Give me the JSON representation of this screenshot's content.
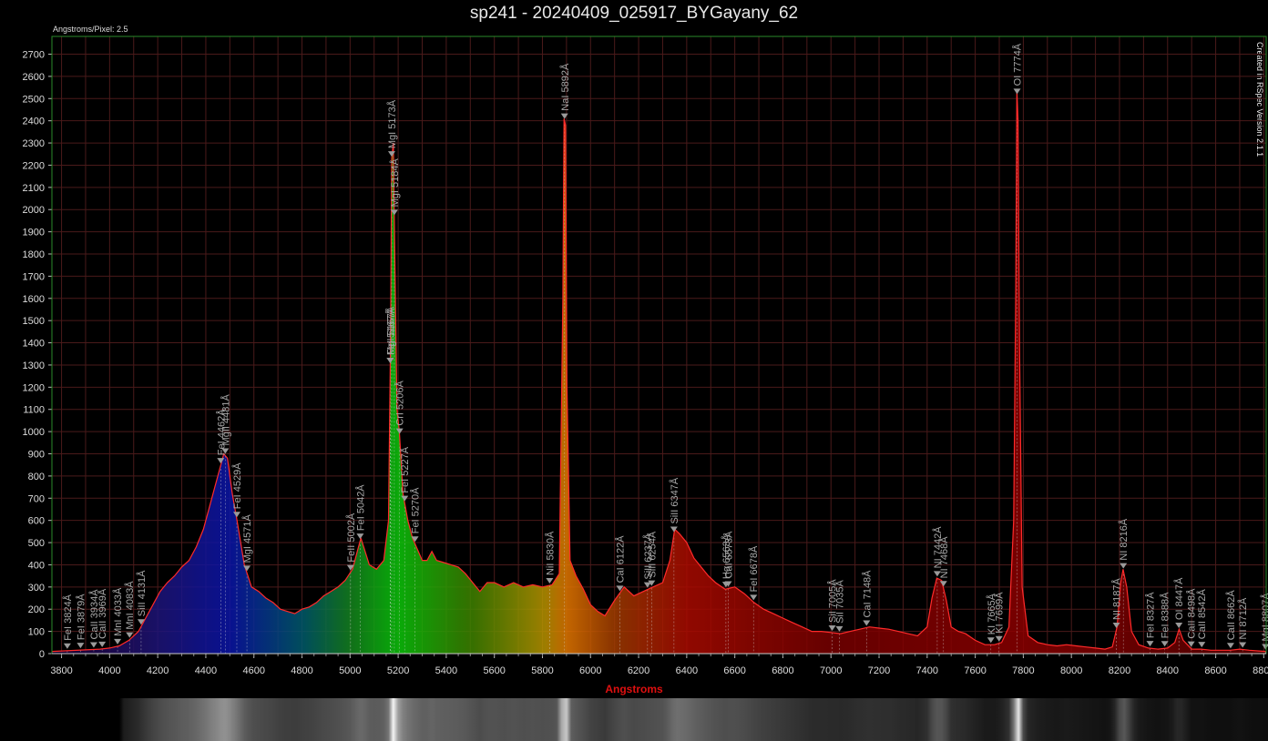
{
  "chart_data": {
    "type": "line",
    "title": "sp241 - 20240409_025917_BYGayany_62",
    "subtitle": "Angstroms/Pixel: 2.5",
    "watermark": "Created in RSpec Version 2.1.1",
    "xlabel": "Angstroms",
    "ylabel": "",
    "xlim": [
      3760,
      8810
    ],
    "ylim": [
      0,
      2780
    ],
    "xticks": [
      3800,
      4000,
      4200,
      4400,
      4600,
      4800,
      5000,
      5200,
      5400,
      5600,
      5800,
      6000,
      6200,
      6400,
      6600,
      6800,
      7000,
      7200,
      7400,
      7600,
      7800,
      8000,
      8200,
      8400,
      8600,
      8800
    ],
    "yticks": [
      0,
      100,
      200,
      300,
      400,
      500,
      600,
      700,
      800,
      900,
      1000,
      1100,
      1200,
      1300,
      1400,
      1500,
      1600,
      1700,
      1800,
      1900,
      2000,
      2100,
      2200,
      2300,
      2400,
      2500,
      2600,
      2700
    ],
    "grid": true,
    "colors": {
      "line": "#ff2a2a",
      "grid": "#4a1a1a",
      "frame": "#2a8a2a",
      "marker": "#9a9a9a",
      "label": "#a8a8a8",
      "xlabel": "#e01010"
    },
    "series": [
      {
        "values": [
          [
            3760,
            10
          ],
          [
            3800,
            12
          ],
          [
            3840,
            14
          ],
          [
            3880,
            16
          ],
          [
            3920,
            18
          ],
          [
            3960,
            20
          ],
          [
            4000,
            25
          ],
          [
            4040,
            35
          ],
          [
            4080,
            60
          ],
          [
            4120,
            100
          ],
          [
            4150,
            160
          ],
          [
            4180,
            220
          ],
          [
            4210,
            280
          ],
          [
            4240,
            320
          ],
          [
            4270,
            350
          ],
          [
            4300,
            390
          ],
          [
            4330,
            420
          ],
          [
            4360,
            480
          ],
          [
            4390,
            560
          ],
          [
            4420,
            680
          ],
          [
            4450,
            800
          ],
          [
            4475,
            900
          ],
          [
            4490,
            880
          ],
          [
            4510,
            720
          ],
          [
            4530,
            600
          ],
          [
            4560,
            400
          ],
          [
            4590,
            300
          ],
          [
            4620,
            280
          ],
          [
            4650,
            250
          ],
          [
            4680,
            230
          ],
          [
            4710,
            200
          ],
          [
            4740,
            190
          ],
          [
            4770,
            180
          ],
          [
            4800,
            200
          ],
          [
            4830,
            210
          ],
          [
            4860,
            230
          ],
          [
            4890,
            260
          ],
          [
            4920,
            280
          ],
          [
            4950,
            300
          ],
          [
            4980,
            330
          ],
          [
            5010,
            380
          ],
          [
            5030,
            460
          ],
          [
            5045,
            520
          ],
          [
            5060,
            470
          ],
          [
            5080,
            400
          ],
          [
            5110,
            380
          ],
          [
            5140,
            420
          ],
          [
            5160,
            600
          ],
          [
            5168,
            1400
          ],
          [
            5173,
            2230
          ],
          [
            5180,
            2300
          ],
          [
            5186,
            1800
          ],
          [
            5195,
            1100
          ],
          [
            5205,
            1000
          ],
          [
            5220,
            720
          ],
          [
            5240,
            600
          ],
          [
            5260,
            520
          ],
          [
            5280,
            470
          ],
          [
            5300,
            420
          ],
          [
            5320,
            420
          ],
          [
            5340,
            460
          ],
          [
            5360,
            420
          ],
          [
            5390,
            410
          ],
          [
            5420,
            400
          ],
          [
            5450,
            390
          ],
          [
            5480,
            360
          ],
          [
            5510,
            320
          ],
          [
            5540,
            280
          ],
          [
            5570,
            320
          ],
          [
            5600,
            320
          ],
          [
            5640,
            300
          ],
          [
            5680,
            320
          ],
          [
            5720,
            300
          ],
          [
            5760,
            310
          ],
          [
            5800,
            300
          ],
          [
            5840,
            310
          ],
          [
            5870,
            360
          ],
          [
            5885,
            1600
          ],
          [
            5890,
            2410
          ],
          [
            5896,
            2380
          ],
          [
            5902,
            1200
          ],
          [
            5915,
            420
          ],
          [
            5940,
            350
          ],
          [
            5970,
            290
          ],
          [
            6000,
            220
          ],
          [
            6030,
            190
          ],
          [
            6060,
            170
          ],
          [
            6100,
            240
          ],
          [
            6140,
            300
          ],
          [
            6180,
            260
          ],
          [
            6220,
            280
          ],
          [
            6260,
            300
          ],
          [
            6300,
            320
          ],
          [
            6330,
            420
          ],
          [
            6350,
            560
          ],
          [
            6370,
            540
          ],
          [
            6400,
            500
          ],
          [
            6430,
            430
          ],
          [
            6460,
            390
          ],
          [
            6490,
            350
          ],
          [
            6520,
            320
          ],
          [
            6560,
            290
          ],
          [
            6600,
            300
          ],
          [
            6640,
            270
          ],
          [
            6680,
            230
          ],
          [
            6720,
            200
          ],
          [
            6760,
            180
          ],
          [
            6800,
            160
          ],
          [
            6840,
            140
          ],
          [
            6880,
            120
          ],
          [
            6920,
            100
          ],
          [
            6960,
            100
          ],
          [
            7000,
            95
          ],
          [
            7040,
            90
          ],
          [
            7080,
            100
          ],
          [
            7120,
            110
          ],
          [
            7160,
            120
          ],
          [
            7200,
            115
          ],
          [
            7240,
            110
          ],
          [
            7280,
            100
          ],
          [
            7320,
            90
          ],
          [
            7360,
            80
          ],
          [
            7400,
            120
          ],
          [
            7420,
            250
          ],
          [
            7440,
            340
          ],
          [
            7460,
            330
          ],
          [
            7480,
            240
          ],
          [
            7500,
            120
          ],
          [
            7530,
            100
          ],
          [
            7560,
            90
          ],
          [
            7600,
            60
          ],
          [
            7640,
            40
          ],
          [
            7680,
            40
          ],
          [
            7710,
            50
          ],
          [
            7740,
            120
          ],
          [
            7760,
            600
          ],
          [
            7768,
            1600
          ],
          [
            7773,
            2540
          ],
          [
            7778,
            2400
          ],
          [
            7784,
            1400
          ],
          [
            7795,
            300
          ],
          [
            7820,
            80
          ],
          [
            7860,
            50
          ],
          [
            7900,
            40
          ],
          [
            7940,
            35
          ],
          [
            7980,
            40
          ],
          [
            8020,
            35
          ],
          [
            8060,
            30
          ],
          [
            8100,
            25
          ],
          [
            8140,
            20
          ],
          [
            8170,
            30
          ],
          [
            8190,
            120
          ],
          [
            8205,
            320
          ],
          [
            8215,
            380
          ],
          [
            8230,
            300
          ],
          [
            8250,
            100
          ],
          [
            8280,
            40
          ],
          [
            8320,
            25
          ],
          [
            8360,
            20
          ],
          [
            8400,
            25
          ],
          [
            8430,
            50
          ],
          [
            8448,
            110
          ],
          [
            8465,
            60
          ],
          [
            8500,
            20
          ],
          [
            8540,
            20
          ],
          [
            8580,
            15
          ],
          [
            8620,
            15
          ],
          [
            8660,
            15
          ],
          [
            8700,
            20
          ],
          [
            8740,
            15
          ],
          [
            8780,
            12
          ],
          [
            8810,
            10
          ]
        ]
      }
    ],
    "lines": [
      {
        "label": "FeI 3824Å",
        "x": 3824
      },
      {
        "label": "FeI 3879Å",
        "x": 3879
      },
      {
        "label": "CaII 3934Å",
        "x": 3934
      },
      {
        "label": "CaII 3969Å",
        "x": 3969
      },
      {
        "label": "MnI 4033Å",
        "x": 4033
      },
      {
        "label": "MnI 4083Å",
        "x": 4083
      },
      {
        "label": "SiII 4131Å",
        "x": 4131
      },
      {
        "label": "FeI 4462Å",
        "x": 4462
      },
      {
        "label": "MgII 4481Å",
        "x": 4481
      },
      {
        "label": "FeI 4529Å",
        "x": 4529
      },
      {
        "label": "MgI 4571Å",
        "x": 4571
      },
      {
        "label": "FeII 5002Å",
        "x": 5002
      },
      {
        "label": "FeI 5042Å",
        "x": 5042
      },
      {
        "label": "MgI 5167Å",
        "x": 5167
      },
      {
        "label": "FeI 5167Å",
        "x": 5167
      },
      {
        "label": "MgI 5173Å",
        "x": 5173
      },
      {
        "label": "MgI 5184Å",
        "x": 5184
      },
      {
        "label": "CrI 5206Å",
        "x": 5206
      },
      {
        "label": "FeI 5227Å",
        "x": 5227
      },
      {
        "label": "FeI 5270Å",
        "x": 5270
      },
      {
        "label": "NiI 5830Å",
        "x": 5830
      },
      {
        "label": "NaI 5892Å",
        "x": 5892
      },
      {
        "label": "CaI 6122Å",
        "x": 6122
      },
      {
        "label": "SiII 6237Å",
        "x": 6237
      },
      {
        "label": "SiII 6254Å",
        "x": 6254
      },
      {
        "label": "SiII 6347Å",
        "x": 6347
      },
      {
        "label": "Hα 6563Å",
        "x": 6563
      },
      {
        "label": "CaI 6573Å",
        "x": 6573
      },
      {
        "label": "FeI 6678Å",
        "x": 6678
      },
      {
        "label": "SiI 7005Å",
        "x": 7005
      },
      {
        "label": "SiI 7035Å",
        "x": 7035
      },
      {
        "label": "CaI 7148Å",
        "x": 7148
      },
      {
        "label": "NI 7442Å",
        "x": 7442
      },
      {
        "label": "NI 7468Å",
        "x": 7468
      },
      {
        "label": "OI 7774Å",
        "x": 7774
      },
      {
        "label": "KI 7665Å",
        "x": 7665
      },
      {
        "label": "KI 7699Å",
        "x": 7699
      },
      {
        "label": "NI 8187Å",
        "x": 8187
      },
      {
        "label": "NI 8216Å",
        "x": 8216
      },
      {
        "label": "FeI 8327Å",
        "x": 8327
      },
      {
        "label": "FeI 8388Å",
        "x": 8388
      },
      {
        "label": "OI 8447Å",
        "x": 8447
      },
      {
        "label": "CaII 8498Å",
        "x": 8498
      },
      {
        "label": "CaII 8542Å",
        "x": 8542
      },
      {
        "label": "CaII 8662Å",
        "x": 8662
      },
      {
        "label": "NI 8712Å",
        "x": 8712
      },
      {
        "label": "MgI 8807Å",
        "x": 8807
      }
    ]
  }
}
